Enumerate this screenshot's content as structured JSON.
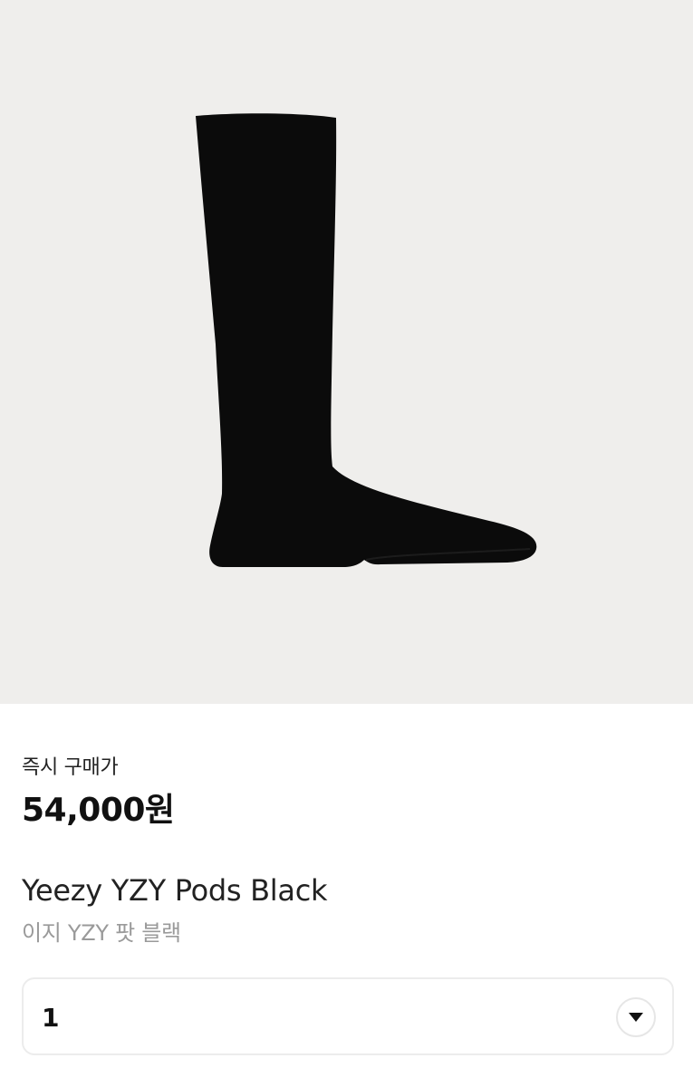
{
  "product": {
    "price_label": "즉시 구매가",
    "price": "54,000원",
    "name": "Yeezy YZY Pods Black",
    "subname": "이지 YZY 팟 블랙"
  },
  "quantity": {
    "selected": "1",
    "icon": "chevron-down-icon"
  },
  "image": {
    "subject": "black-sock-shoe",
    "background": "#efeeec",
    "fill": "#0b0b0b"
  }
}
